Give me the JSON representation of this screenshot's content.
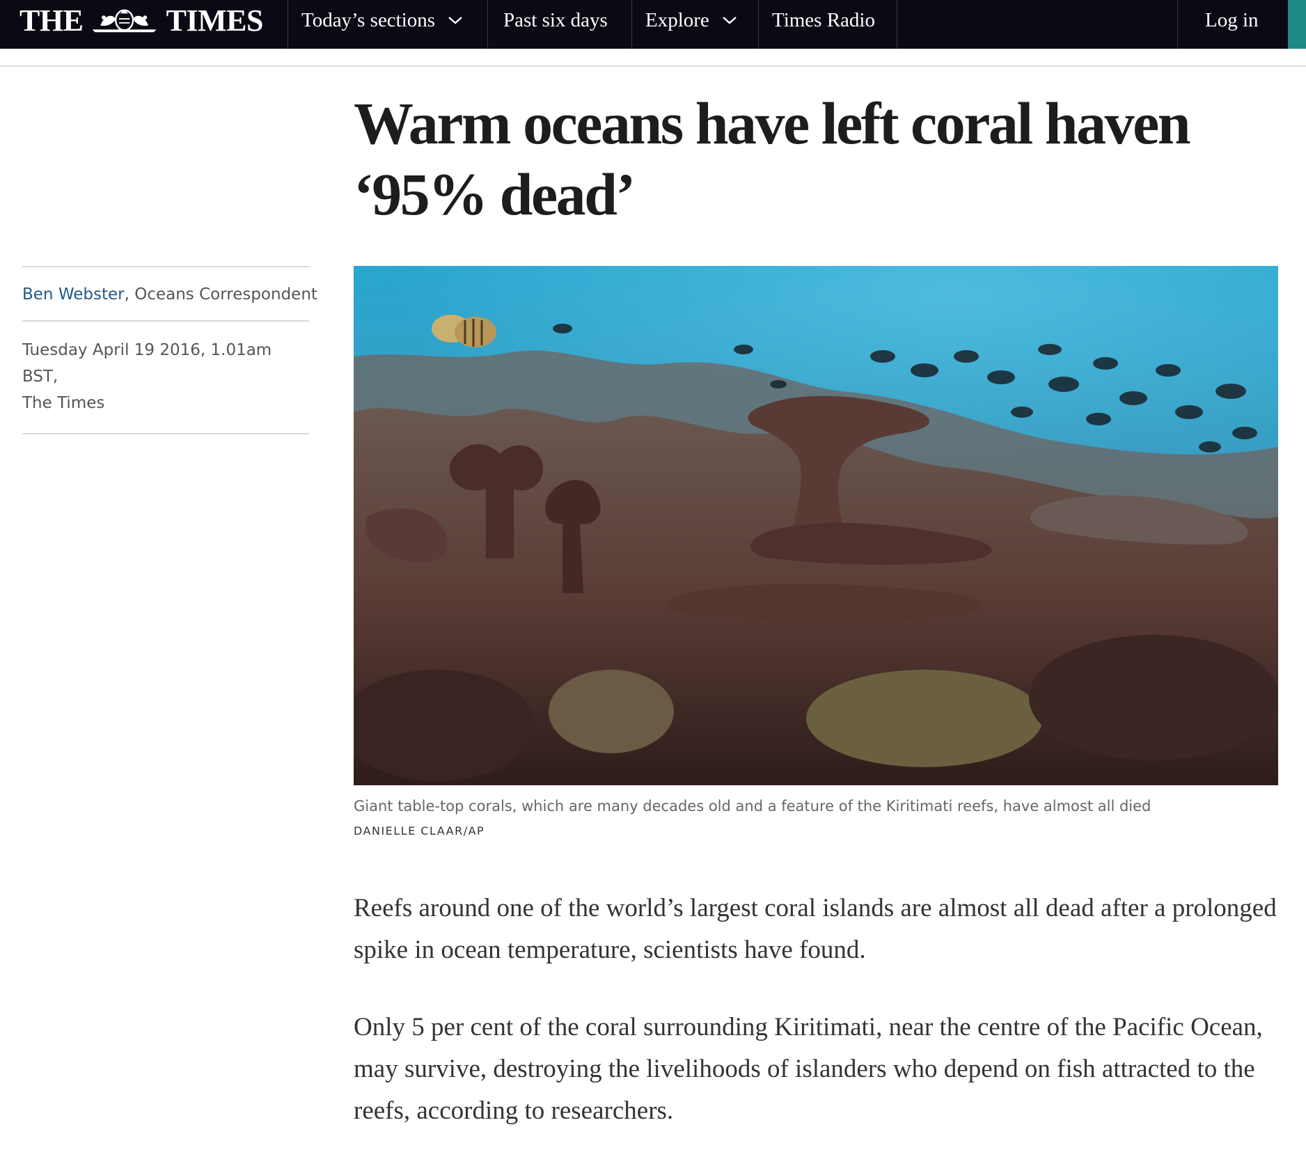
{
  "nav": {
    "logo_left": "THE",
    "logo_right": "TIMES",
    "items": [
      {
        "label": "Today’s sections",
        "has_dropdown": true,
        "icon": "chevron-down-icon"
      },
      {
        "label": "Past six days",
        "has_dropdown": false
      },
      {
        "label": "Explore",
        "has_dropdown": true,
        "icon": "chevron-down-icon"
      },
      {
        "label": "Times Radio",
        "has_dropdown": false
      }
    ],
    "login_label": "Log in",
    "background_color": "#0a0a14",
    "accent_color": "#1d8a85"
  },
  "article": {
    "headline": "Warm oceans have left coral haven ‘95% dead’",
    "author": "Ben Webster",
    "author_role": ", Oceans Correspondent",
    "date": "Tuesday April 19 2016, 1.01am BST,",
    "publication": "The Times",
    "image": {
      "description_icon": "coral-reef-photo",
      "caption": "Giant table-top corals, which are many decades old and a feature of the Kiritimati reefs, have almost all died",
      "credit": "DANIELLE CLAAR/AP"
    },
    "paragraphs": [
      "Reefs around one of the world’s largest coral islands are almost all dead after a prolonged spike in ocean temperature, scientists have found.",
      "Only 5 per cent of the coral surrounding Kiritimati, near the centre of the Pacific Ocean, may survive, destroying the livelihoods of islanders who depend on fish attracted to the reefs, according to researchers."
    ],
    "author_link_color": "#1f5a8a"
  }
}
